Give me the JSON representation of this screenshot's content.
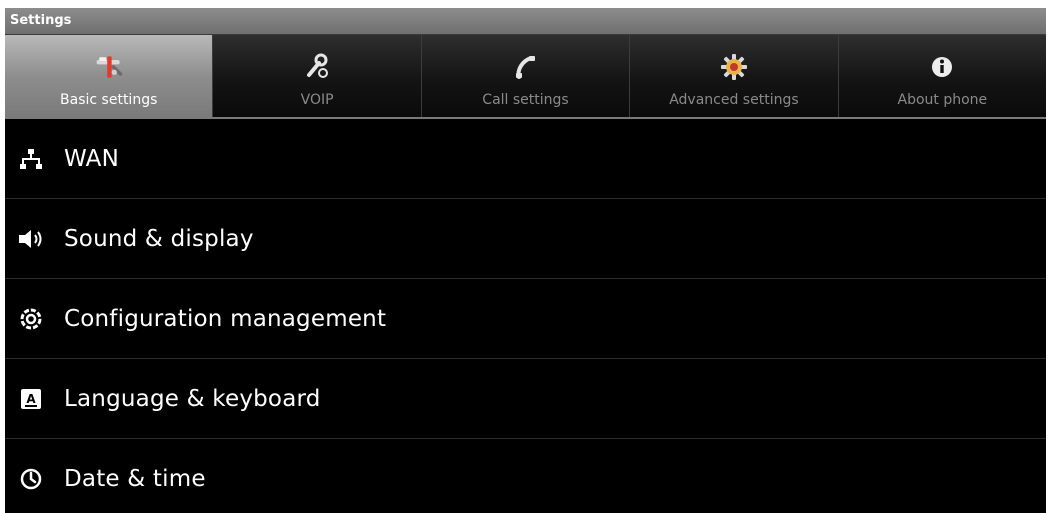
{
  "window": {
    "title": "Settings"
  },
  "tabs": [
    {
      "label": "Basic settings",
      "icon": "tools-icon",
      "active": true
    },
    {
      "label": "VOIP",
      "icon": "wrench-icon",
      "active": false
    },
    {
      "label": "Call settings",
      "icon": "phone-icon",
      "active": false
    },
    {
      "label": "Advanced settings",
      "icon": "gear-icon",
      "active": false
    },
    {
      "label": "About phone",
      "icon": "info-icon",
      "active": false
    }
  ],
  "menu": {
    "items": [
      {
        "label": "WAN",
        "icon": "network-icon"
      },
      {
        "label": "Sound & display",
        "icon": "speaker-icon"
      },
      {
        "label": "Configuration management",
        "icon": "settings-icon"
      },
      {
        "label": "Language & keyboard",
        "icon": "keyboard-icon"
      },
      {
        "label": "Date & time",
        "icon": "clock-icon"
      }
    ]
  },
  "colors": {
    "background": "#000000",
    "titlebar": "#7f7f7f",
    "active_tab": "#a0a0a0",
    "text": "#ffffff",
    "inactive_tab_text": "#8a8a8a"
  }
}
